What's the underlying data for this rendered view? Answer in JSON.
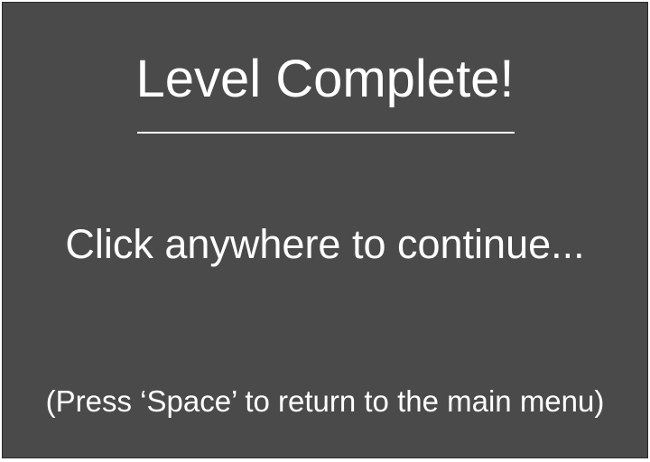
{
  "screen": {
    "title": "Level Complete!",
    "prompt": "Click anywhere to continue...",
    "hint": "(Press ‘Space’ to return to the main menu)"
  },
  "colors": {
    "background": "#4a4a4a",
    "text": "#ffffff",
    "border": "#2a2a2a"
  }
}
